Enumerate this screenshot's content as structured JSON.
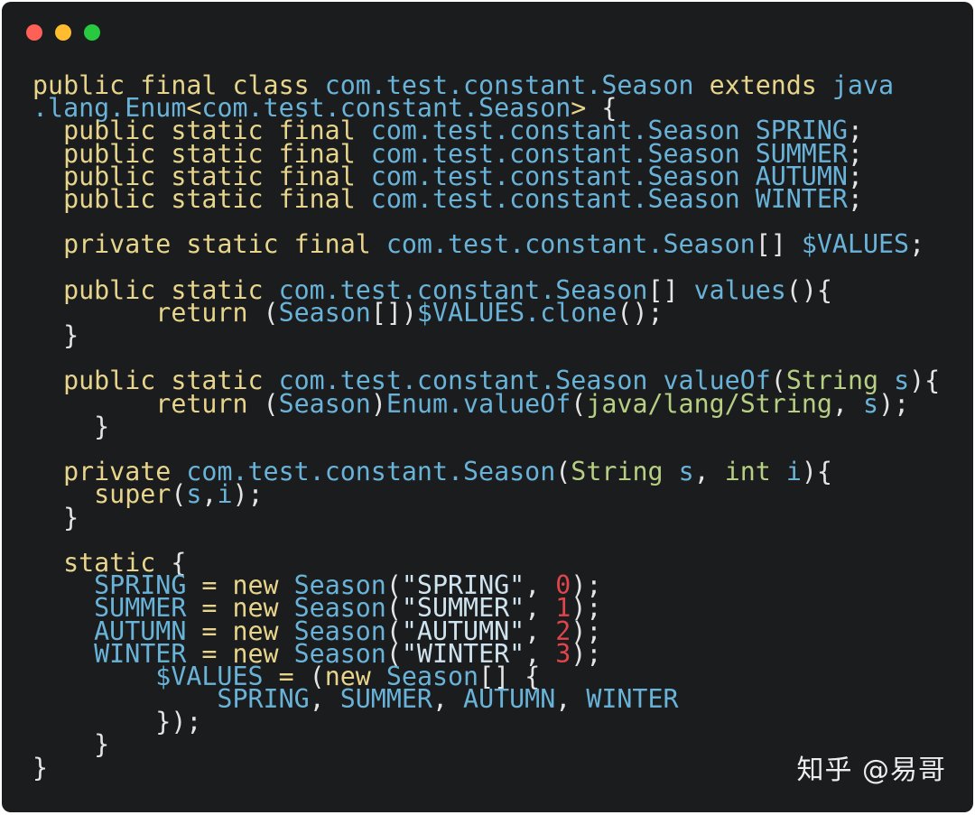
{
  "window": {
    "colors": {
      "background": "#1b1c1e",
      "close": "#fe5f57",
      "minimize": "#febc2e",
      "zoom": "#28c840"
    }
  },
  "colors": {
    "kw": "#e8d58c",
    "ty": "#69b3d9",
    "op": "#e4e4e4",
    "str": "#cfe4ee",
    "num": "#e0454b",
    "pk": "#b7cf82"
  },
  "code": {
    "lines": [
      [
        [
          "kw",
          "public final class "
        ],
        [
          "ty",
          "com.test.constant.Season "
        ],
        [
          "kw",
          "extends "
        ],
        [
          "ty",
          "java"
        ]
      ],
      [
        [
          "ty",
          ".lang.Enum"
        ],
        [
          "kw",
          "<"
        ],
        [
          "ty",
          "com.test.constant.Season"
        ],
        [
          "kw",
          "> "
        ],
        [
          "op",
          "{"
        ]
      ],
      [
        [
          "kw",
          "  public static final "
        ],
        [
          "ty",
          "com.test.constant.Season SPRING"
        ],
        [
          "op",
          ";"
        ]
      ],
      [
        [
          "kw",
          "  public static final "
        ],
        [
          "ty",
          "com.test.constant.Season SUMMER"
        ],
        [
          "op",
          ";"
        ]
      ],
      [
        [
          "kw",
          "  public static final "
        ],
        [
          "ty",
          "com.test.constant.Season AUTUMN"
        ],
        [
          "op",
          ";"
        ]
      ],
      [
        [
          "kw",
          "  public static final "
        ],
        [
          "ty",
          "com.test.constant.Season WINTER"
        ],
        [
          "op",
          ";"
        ]
      ],
      [],
      [
        [
          "kw",
          "  private static final "
        ],
        [
          "ty",
          "com.test.constant.Season"
        ],
        [
          "op",
          "[] "
        ],
        [
          "ty",
          "$VALUES"
        ],
        [
          "op",
          ";"
        ]
      ],
      [],
      [
        [
          "kw",
          "  public static "
        ],
        [
          "ty",
          "com.test.constant.Season"
        ],
        [
          "op",
          "[] "
        ],
        [
          "ty",
          "values"
        ],
        [
          "op",
          "(){"
        ]
      ],
      [
        [
          "kw",
          "        return "
        ],
        [
          "op",
          "("
        ],
        [
          "ty",
          "Season"
        ],
        [
          "op",
          "[])"
        ],
        [
          "ty",
          "$VALUES.clone"
        ],
        [
          "op",
          "();"
        ]
      ],
      [
        [
          "op",
          "  }"
        ]
      ],
      [],
      [
        [
          "kw",
          "  public static "
        ],
        [
          "ty",
          "com.test.constant.Season valueOf"
        ],
        [
          "op",
          "("
        ],
        [
          "pk",
          "String "
        ],
        [
          "ty",
          "s"
        ],
        [
          "op",
          "){"
        ]
      ],
      [
        [
          "kw",
          "        return "
        ],
        [
          "op",
          "("
        ],
        [
          "ty",
          "Season"
        ],
        [
          "op",
          ")"
        ],
        [
          "ty",
          "Enum.valueOf"
        ],
        [
          "op",
          "("
        ],
        [
          "pk",
          "java/lang/String"
        ],
        [
          "op",
          ", "
        ],
        [
          "ty",
          "s"
        ],
        [
          "op",
          ");"
        ]
      ],
      [
        [
          "op",
          "    }"
        ]
      ],
      [],
      [
        [
          "kw",
          "  private "
        ],
        [
          "ty",
          "com.test.constant.Season"
        ],
        [
          "op",
          "("
        ],
        [
          "pk",
          "String "
        ],
        [
          "ty",
          "s"
        ],
        [
          "op",
          ", "
        ],
        [
          "pk",
          "int "
        ],
        [
          "ty",
          "i"
        ],
        [
          "op",
          "){"
        ]
      ],
      [
        [
          "kw",
          "    super"
        ],
        [
          "op",
          "("
        ],
        [
          "ty",
          "s"
        ],
        [
          "op",
          ","
        ],
        [
          "ty",
          "i"
        ],
        [
          "op",
          ");"
        ]
      ],
      [
        [
          "op",
          "  }"
        ]
      ],
      [],
      [
        [
          "kw",
          "  static "
        ],
        [
          "op",
          "{"
        ]
      ],
      [
        [
          "ty",
          "    SPRING "
        ],
        [
          "kw",
          "= new "
        ],
        [
          "ty",
          "Season"
        ],
        [
          "op",
          "("
        ],
        [
          "str",
          "\"SPRING\""
        ],
        [
          "op",
          ", "
        ],
        [
          "num",
          "0"
        ],
        [
          "op",
          ");"
        ]
      ],
      [
        [
          "ty",
          "    SUMMER "
        ],
        [
          "kw",
          "= new "
        ],
        [
          "ty",
          "Season"
        ],
        [
          "op",
          "("
        ],
        [
          "str",
          "\"SUMMER\""
        ],
        [
          "op",
          ", "
        ],
        [
          "num",
          "1"
        ],
        [
          "op",
          ");"
        ]
      ],
      [
        [
          "ty",
          "    AUTUMN "
        ],
        [
          "kw",
          "= new "
        ],
        [
          "ty",
          "Season"
        ],
        [
          "op",
          "("
        ],
        [
          "str",
          "\"AUTUMN\""
        ],
        [
          "op",
          ", "
        ],
        [
          "num",
          "2"
        ],
        [
          "op",
          ");"
        ]
      ],
      [
        [
          "ty",
          "    WINTER "
        ],
        [
          "kw",
          "= new "
        ],
        [
          "ty",
          "Season"
        ],
        [
          "op",
          "("
        ],
        [
          "str",
          "\"WINTER\""
        ],
        [
          "op",
          ", "
        ],
        [
          "num",
          "3"
        ],
        [
          "op",
          ");"
        ]
      ],
      [
        [
          "ty",
          "        $VALUES "
        ],
        [
          "kw",
          "= "
        ],
        [
          "op",
          "("
        ],
        [
          "kw",
          "new "
        ],
        [
          "ty",
          "Season"
        ],
        [
          "op",
          "[] {"
        ]
      ],
      [
        [
          "ty",
          "            SPRING"
        ],
        [
          "op",
          ", "
        ],
        [
          "ty",
          "SUMMER"
        ],
        [
          "op",
          ", "
        ],
        [
          "ty",
          "AUTUMN"
        ],
        [
          "op",
          ", "
        ],
        [
          "ty",
          "WINTER"
        ]
      ],
      [
        [
          "op",
          "        });"
        ]
      ],
      [
        [
          "op",
          "    }"
        ]
      ],
      [
        [
          "op",
          "}"
        ]
      ]
    ]
  },
  "watermark": {
    "text": "知乎 @易哥"
  }
}
